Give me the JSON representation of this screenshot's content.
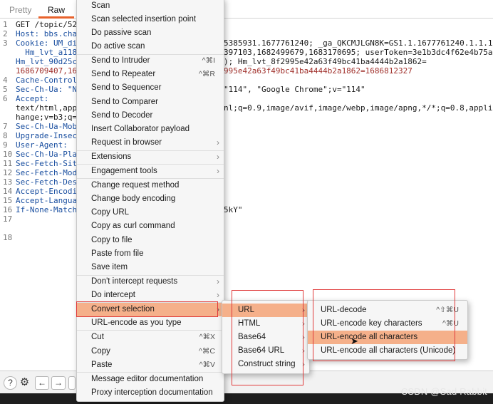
{
  "tabs": {
    "pretty": "Pretty",
    "raw": "Raw"
  },
  "gutter": [
    "1",
    "2",
    "3",
    "",
    "",
    "",
    "4",
    "5",
    "6",
    "",
    "",
    "7",
    "8",
    "9",
    "10",
    "11",
    "12",
    "13",
    "14",
    "15",
    "16",
    "17",
    "18"
  ],
  "code_left": [
    "GET /topic/52",
    "Host: bbs.cha",
    "Cookie: UM_di",
    "  Hm_lvt_a1181",
    "Hm_lvt_90d25c",
    "1686709407,16",
    "Cache-Control",
    "Sec-Ch-Ua: \"N",
    "Accept:",
    "text/html,app",
    "hange;v=b3;q=",
    "Sec-Ch-Ua-Mob",
    "Upgrade-Insec",
    "User-Agent: ",
    "Sec-Ch-Ua-Pla",
    "Sec-Fetch-Sit",
    "Sec-Fetch-Mod",
    "Sec-Fetch-Des",
    "Accept-Encodi",
    "Accept-Langua",
    "If-None-Match"
  ],
  "code_right": {
    "cookie_1": "5385931.1677761240; _ga_QKCMJLGN8K=GS1.1.1677761240.1.1.1677",
    "cookie_2": "397103,1682499679,1683170695; userToken=3e1b3dc4f62e4b75aa76",
    "cookie_3": "); Hm_lvt_8f2995e42a63f49bc41ba4444b2a1862=",
    "cookie_4": "995e42a63f49bc41ba4444b2a1862=1686812327",
    "ua": "\"114\", \"Google Chrome\";v=\"114\"",
    "accept": "nl;q=0.9,image/avif,image/webp,image/apng,*/*;q=0.8,applicat",
    "etag": "5kY\""
  },
  "main_menu": {
    "items": [
      {
        "label": "Scan"
      },
      {
        "label": "Scan selected insertion point"
      },
      {
        "label": "Do passive scan"
      },
      {
        "label": "Do active scan"
      },
      {
        "label": "Send to Intruder",
        "shortcut": "^⌘I"
      },
      {
        "label": "Send to Repeater",
        "shortcut": "^⌘R"
      },
      {
        "label": "Send to Sequencer"
      },
      {
        "label": "Send to Comparer"
      },
      {
        "label": "Send to Decoder"
      },
      {
        "label": "Insert Collaborator payload"
      },
      {
        "label": "Request in browser"
      },
      {
        "label": "Extensions"
      },
      {
        "label": "Engagement tools"
      },
      {
        "label": "Change request method"
      },
      {
        "label": "Change body encoding"
      },
      {
        "label": "Copy URL"
      },
      {
        "label": "Copy as curl command"
      },
      {
        "label": "Copy to file"
      },
      {
        "label": "Paste from file"
      },
      {
        "label": "Save item"
      },
      {
        "label": "Don't intercept requests"
      },
      {
        "label": "Do intercept"
      },
      {
        "label": "Convert selection"
      },
      {
        "label": "URL-encode as you type"
      },
      {
        "label": "Cut",
        "shortcut": "^⌘X"
      },
      {
        "label": "Copy",
        "shortcut": "^⌘C"
      },
      {
        "label": "Paste",
        "shortcut": "^⌘V"
      },
      {
        "label": "Message editor documentation"
      },
      {
        "label": "Proxy interception documentation"
      }
    ]
  },
  "convert_menu": {
    "items": [
      {
        "label": "URL"
      },
      {
        "label": "HTML"
      },
      {
        "label": "Base64"
      },
      {
        "label": "Base64 URL"
      },
      {
        "label": "Construct string"
      }
    ]
  },
  "url_menu": {
    "items": [
      {
        "label": "URL-decode",
        "shortcut": "^⇧⌘U"
      },
      {
        "label": "URL-encode key characters",
        "shortcut": "^⌘U"
      },
      {
        "label": "URL-encode all characters"
      },
      {
        "label": "URL-encode all characters (Unicode)"
      }
    ]
  },
  "statusbar": {
    "back": "←",
    "forward": "→"
  },
  "watermark": "CSDN @Sad Rabbit",
  "colors": {
    "highlight": "#f5b08a",
    "tab_accent": "#e8622c",
    "annotation": "#e03b3b"
  },
  "icons": [
    "help-icon",
    "settings-icon",
    "arrow-left-icon",
    "arrow-right-icon",
    "chevron-right-icon",
    "pointer-cursor-icon"
  ]
}
